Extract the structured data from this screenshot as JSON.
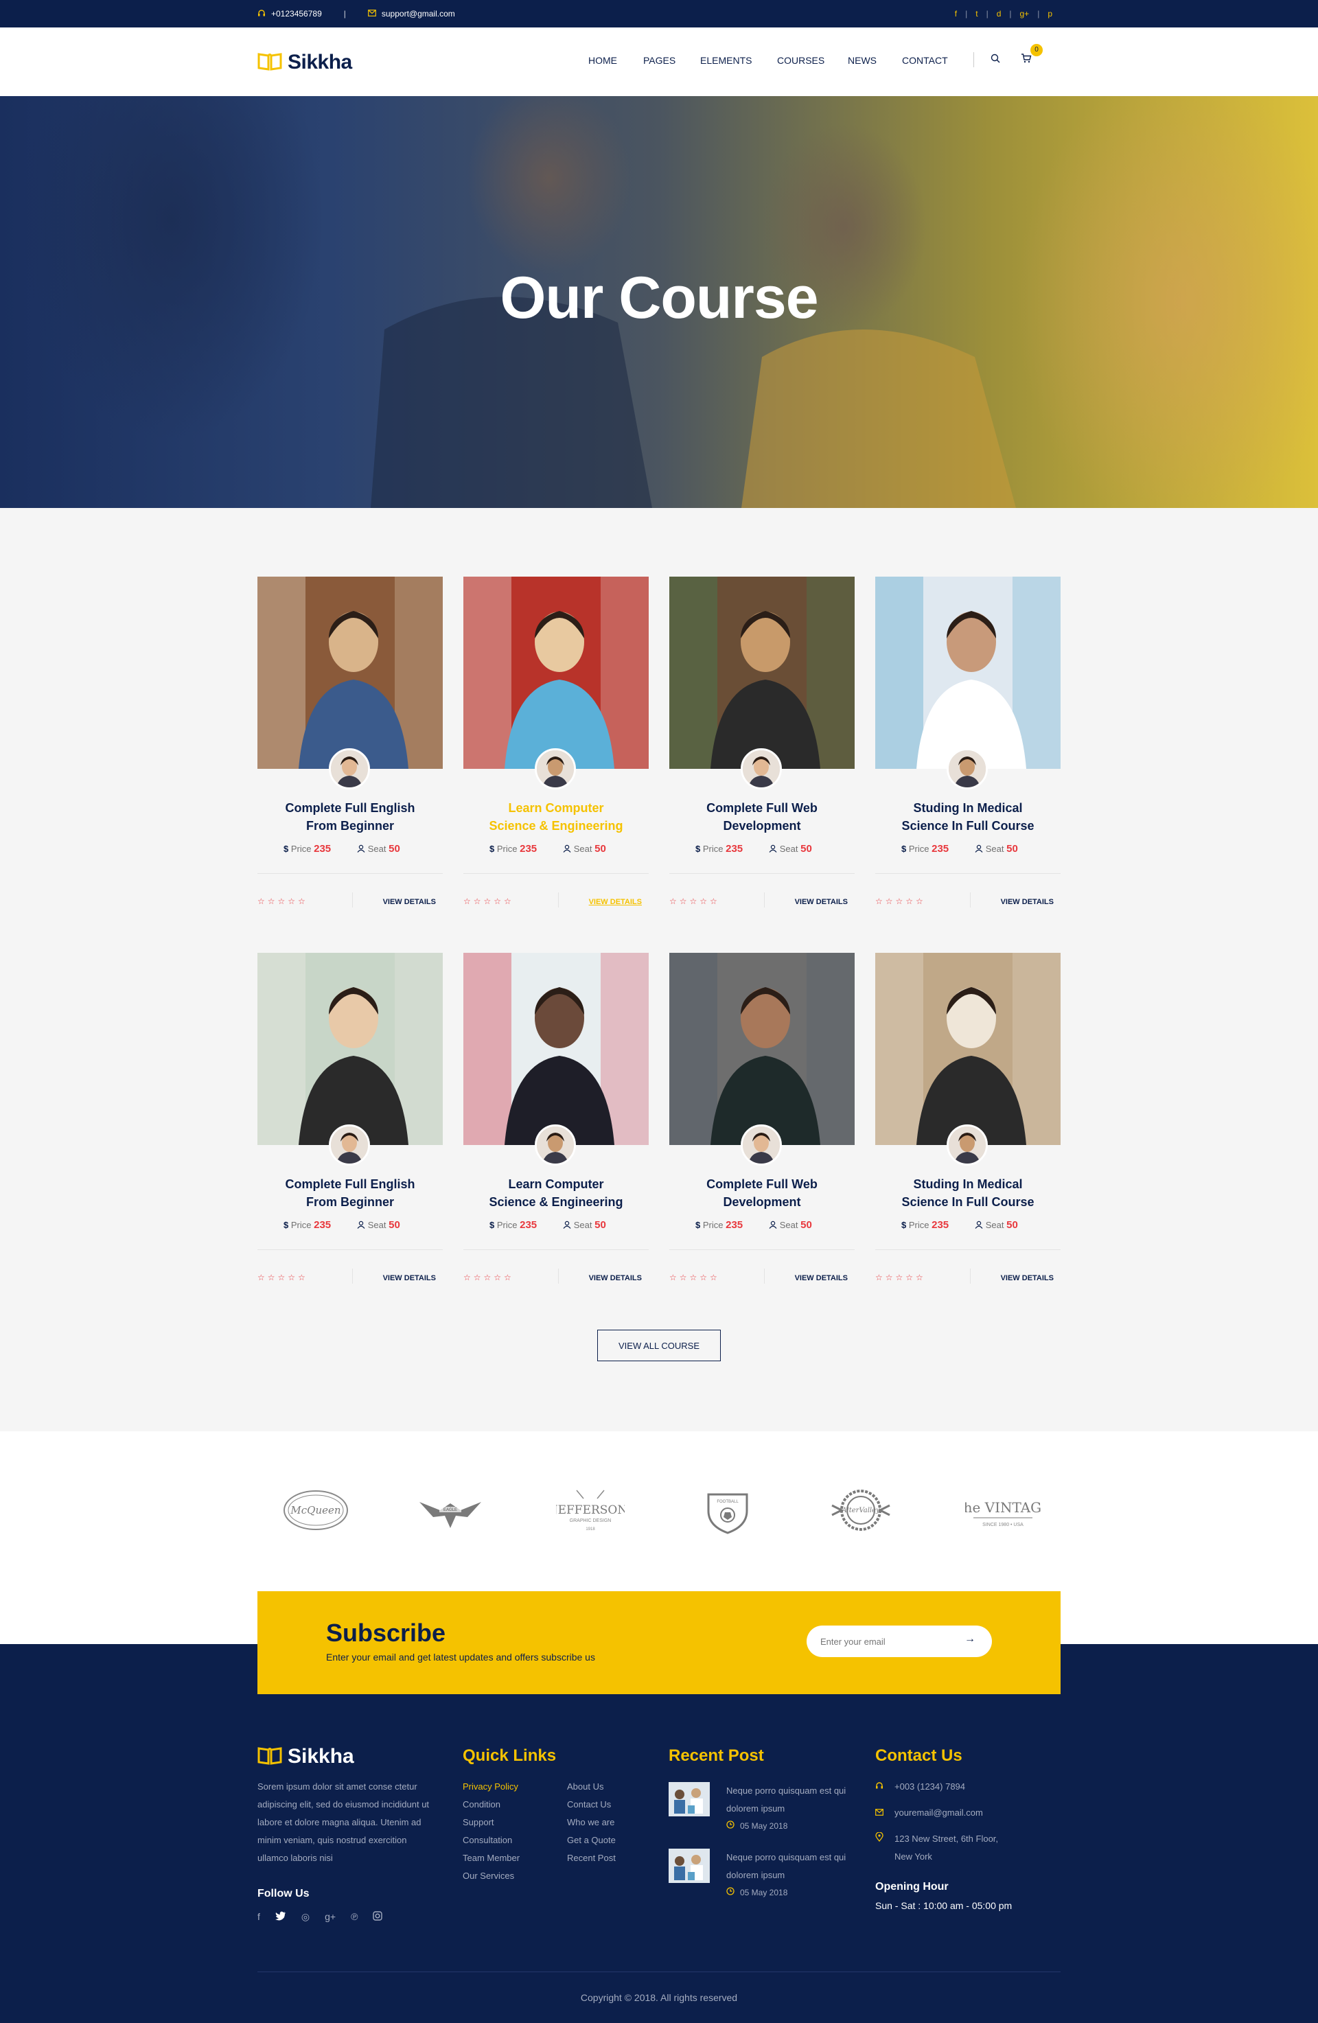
{
  "topbar": {
    "phone": "+0123456789",
    "email": "support@gmail.com",
    "separator": "|",
    "social": [
      "f",
      "t",
      "d",
      "g+",
      "p"
    ]
  },
  "brand": {
    "name": "Sikkha"
  },
  "nav": {
    "items": [
      "HOME",
      "PAGES",
      "ELEMENTS",
      "COURSES",
      "NEWS",
      "CONTACT"
    ],
    "cart_count": "0"
  },
  "hero": {
    "title": "Our Course"
  },
  "courses": {
    "items": [
      {
        "title1": "Complete Full English",
        "title2": "From Beginner",
        "price_label": "Price",
        "price": "235",
        "seat_label": "Seat",
        "seat": "50",
        "details": "VIEW DETAILS"
      },
      {
        "title1": "Learn Computer",
        "title2": "Science & Engineering",
        "price_label": "Price",
        "price": "235",
        "seat_label": "Seat",
        "seat": "50",
        "details": "VIEW DETAILS"
      },
      {
        "title1": "Complete Full Web",
        "title2": "Development",
        "price_label": "Price",
        "price": "235",
        "seat_label": "Seat",
        "seat": "50",
        "details": "VIEW DETAILS"
      },
      {
        "title1": "Studing In Medical",
        "title2": "Science In Full Course",
        "price_label": "Price",
        "price": "235",
        "seat_label": "Seat",
        "seat": "50",
        "details": "VIEW DETAILS"
      },
      {
        "title1": "Complete Full English",
        "title2": "From Beginner",
        "price_label": "Price",
        "price": "235",
        "seat_label": "Seat",
        "seat": "50",
        "details": "VIEW DETAILS"
      },
      {
        "title1": "Learn Computer",
        "title2": "Science & Engineering",
        "price_label": "Price",
        "price": "235",
        "seat_label": "Seat",
        "seat": "50",
        "details": "VIEW DETAILS"
      },
      {
        "title1": "Complete Full Web",
        "title2": "Development",
        "price_label": "Price",
        "price": "235",
        "seat_label": "Seat",
        "seat": "50",
        "details": "VIEW DETAILS"
      },
      {
        "title1": "Studing In Medical",
        "title2": "Science In Full Course",
        "price_label": "Price",
        "price": "235",
        "seat_label": "Seat",
        "seat": "50",
        "details": "VIEW DETAILS"
      }
    ],
    "currency": "$",
    "rating_stars": "☆☆☆☆☆",
    "view_all": "VIEW ALL COURSE"
  },
  "brands": [
    "McQueen",
    "EAGLE",
    "JEFFERSON",
    "FOOTBALL",
    "AlterValley",
    "The VINTAGE"
  ],
  "subscribe": {
    "title": "Subscribe",
    "text": "Enter  your email and get latest updates and offers subscribe us",
    "placeholder": "Enter your email",
    "arrow": "→"
  },
  "footer": {
    "about": "Sorem ipsum dolor sit amet conse ctetur adipiscing elit, sed do eiusmod  incididunt ut labore et dolore magna aliqua. Utenim ad minim veniam, quis nostrud exercition ullamco laboris nisi",
    "follow_title": "Follow Us",
    "quick_links_title": "Quick Links",
    "links_col1": [
      "Privacy Policy",
      "Condition",
      "Support",
      "Consultation",
      "Team Member",
      "Our Services"
    ],
    "links_col2": [
      "About Us",
      "Contact Us",
      "Who we are",
      "Get a Quote",
      "Recent Post"
    ],
    "recent_title": "Recent Post",
    "posts": [
      {
        "text": "Neque porro quisquam est qui dolorem ipsum",
        "date": "05 May 2018"
      },
      {
        "text": "Neque porro quisquam est qui dolorem ipsum",
        "date": "05 May 2018"
      }
    ],
    "contact_title": "Contact Us",
    "phone": "+003 (1234) 7894",
    "email": "youremail@gmail.com",
    "address1": "123 New Street, 6th Floor,",
    "address2": "New York",
    "hours_title": "Opening Hour",
    "hours": "Sun - Sat : 10:00 am - 05:00 pm",
    "copyright": "Copyright © 2018. All rights reserved"
  },
  "colors": {
    "navy": "#0c1f4b",
    "yellow": "#f5c200",
    "red": "#e8383d"
  }
}
